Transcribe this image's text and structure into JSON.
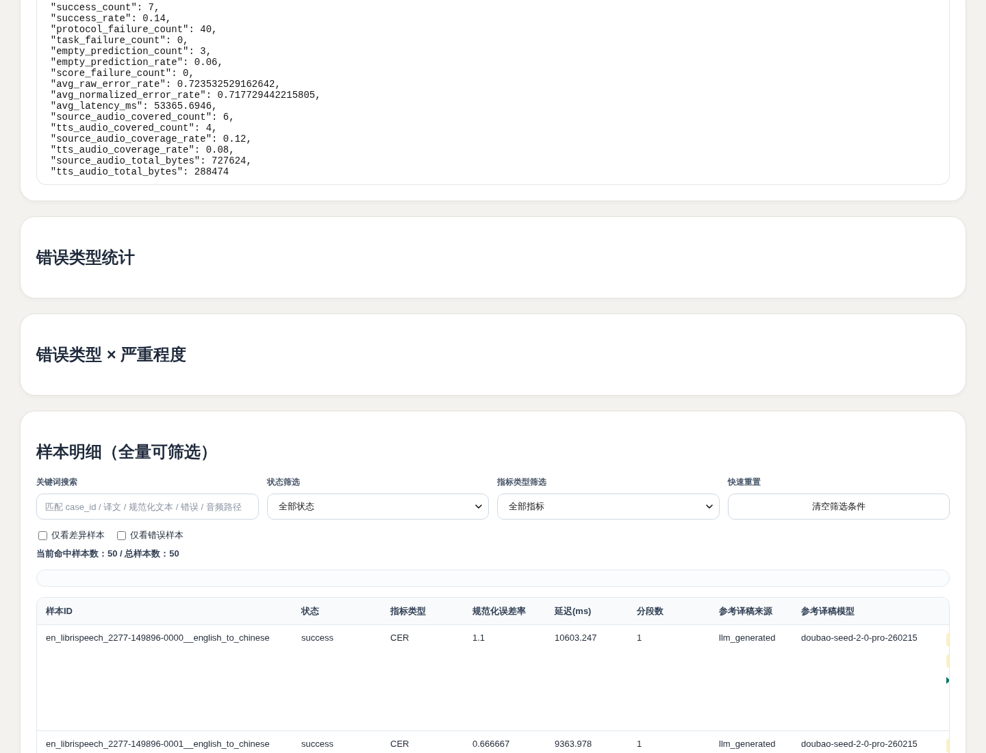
{
  "summary": {
    "code_lines": [
      "\"success_count\": 7,",
      "\"success_rate\": 0.14,",
      "\"protocol_failure_count\": 40,",
      "\"task_failure_count\": 0,",
      "\"empty_prediction_count\": 3,",
      "\"empty_prediction_rate\": 0.06,",
      "\"score_failure_count\": 0,",
      "\"avg_raw_error_rate\": 0.723532529162642,",
      "\"avg_normalized_error_rate\": 0.717729442215805,",
      "\"avg_latency_ms\": 53365.6946,",
      "\"source_audio_covered_count\": 6,",
      "\"tts_audio_covered_count\": 4,",
      "\"source_audio_coverage_rate\": 0.12,",
      "\"tts_audio_coverage_rate\": 0.08,",
      "\"source_audio_total_bytes\": 727624,",
      "\"tts_audio_total_bytes\": 288474"
    ]
  },
  "sections": [
    {
      "title": "错误类型统计"
    },
    {
      "title": "错误类型 × 严重程度"
    }
  ],
  "samples": {
    "title": "样本明细（全量可筛选）",
    "filters": [
      {
        "kind": "search",
        "label": "关键词搜索",
        "placeholder": "匹配 case_id / 译文 / 规范化文本 / 错误 / 音频路径"
      },
      {
        "kind": "select",
        "label": "状态筛选",
        "value": "全部状态"
      },
      {
        "kind": "select",
        "label": "指标类型筛选",
        "value": "全部指标"
      },
      {
        "kind": "button",
        "label": "快速重置",
        "text": "清空筛选条件"
      }
    ],
    "toggles": [
      {
        "label": "仅看差异样本",
        "checked": false
      },
      {
        "label": "仅看错误样本",
        "checked": false
      }
    ],
    "count_text": "当前命中样本数：50 / 总样本数：50",
    "table": {
      "columns": [
        "样本ID",
        "状态",
        "指标类型",
        "规范化误差率",
        "延迟(ms)",
        "分段数",
        "参考译稿来源",
        "参考译稿模型"
      ],
      "rows": [
        {
          "cells": [
            "en_librispeech_2277-149896-0000__english_to_chinese",
            "success",
            "CER",
            "1.1",
            "10603.247",
            "1",
            "llm_generated",
            "doubao-seed-2-0-pro-260215"
          ],
          "column_9": [
            {
              "kind": "tag"
            },
            {
              "kind": "tag"
            },
            {
              "kind": "toggle"
            }
          ]
        },
        {
          "cells": [
            "en_librispeech_2277-149896-0001__english_to_chinese",
            "success",
            "CER",
            "0.666667",
            "9363.978",
            "1",
            "llm_generated",
            "doubao-seed-2-0-pro-260215"
          ],
          "column_9": [
            {
              "kind": "tag"
            }
          ]
        }
      ]
    }
  }
}
